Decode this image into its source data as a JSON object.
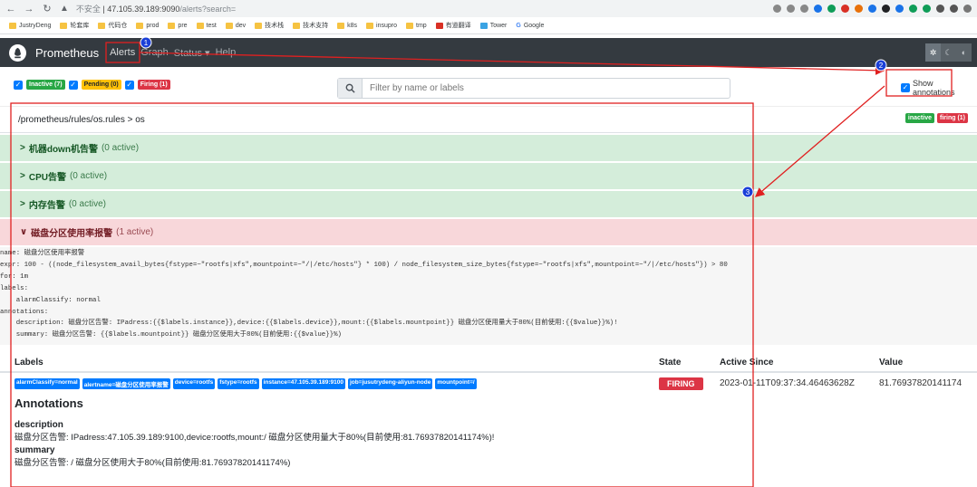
{
  "browser": {
    "not_secure": "不安全",
    "url_host": "47.105.39.189:9090",
    "url_path": "/alerts?search="
  },
  "bookmarks": [
    "JustryDeng",
    "轮套库",
    "代码仓",
    "prod",
    "pre",
    "test",
    "dev",
    "技术栈",
    "技术支持",
    "k8s",
    "insupro",
    "tmp",
    "有道翻译",
    "Tower",
    "Google"
  ],
  "navbar": {
    "brand": "Prometheus",
    "links": [
      "Alerts",
      "Graph",
      "Status",
      "Help"
    ],
    "status_caret": "▾"
  },
  "filters": {
    "inactive": "Inactive (7)",
    "pending": "Pending (0)",
    "firing": "Firing (1)",
    "search_placeholder": "Filter by name or labels",
    "show_annotations": "Show annotations"
  },
  "file": {
    "path": "/prometheus/rules/os.rules > os",
    "tag_inactive": "inactive",
    "tag_firing": "firing (1)"
  },
  "groups": [
    {
      "name": "机器down机告警",
      "count": "(0 active)",
      "state": "inactive"
    },
    {
      "name": "CPU告警",
      "count": "(0 active)",
      "state": "inactive"
    },
    {
      "name": "内存告警",
      "count": "(0 active)",
      "state": "inactive"
    },
    {
      "name": "磁盘分区使用率报警",
      "count": "(1 active)",
      "state": "firing"
    }
  ],
  "rule": {
    "l1": "name: 磁盘分区使用率报警",
    "l2": "expr: 100 - ((node_filesystem_avail_bytes{fstype=~\"rootfs|xfs\",mountpoint=~\"/|/etc/hosts\"} * 100) / node_filesystem_size_bytes{fstype=~\"rootfs|xfs\",mountpoint=~\"/|/etc/hosts\"}) > 80",
    "l3": "for: 1m",
    "l4": "labels:",
    "l5": "    alarmClassify: normal",
    "l6": "annotations:",
    "l7": "    description: 磁盘分区告警: IPadress:{{$labels.instance}},device:{{$labels.device}},mount:{{$labels.mountpoint}} 磁盘分区使用量大于80%(目前使用:{{$value}}%)!",
    "l8": "    summary: 磁盘分区告警: {{$labels.mountpoint}} 磁盘分区使用大于80%(目前使用:{{$value}}%)"
  },
  "table": {
    "headers": [
      "Labels",
      "State",
      "Active Since",
      "Value"
    ],
    "labels": [
      "alarmClassify=normal",
      "alertname=磁盘分区使用率报警",
      "device=rootfs",
      "fstype=rootfs",
      "instance=47.105.39.189:9100",
      "job=jusutrydeng-aliyun-node",
      "mountpoint=/"
    ],
    "state": "FIRING",
    "active_since": "2023-01-11T09:37:34.46463628Z",
    "value": "81.76937820141174"
  },
  "annotations": {
    "title": "Annotations",
    "description_key": "description",
    "description_value": "磁盘分区告警: IPadress:47.105.39.189:9100,device:rootfs,mount:/ 磁盘分区使用量大于80%(目前使用:81.76937820141174%)!",
    "summary_key": "summary",
    "summary_value": "磁盘分区告警: / 磁盘分区使用大于80%(目前使用:81.76937820141174%)"
  },
  "markers": [
    "1",
    "2",
    "3"
  ],
  "colors": {
    "accent": "#007bff",
    "firing": "#dc3545",
    "inactive_bg": "#d4edda",
    "firing_bg": "#f8d7da",
    "annot": "#e02020"
  }
}
